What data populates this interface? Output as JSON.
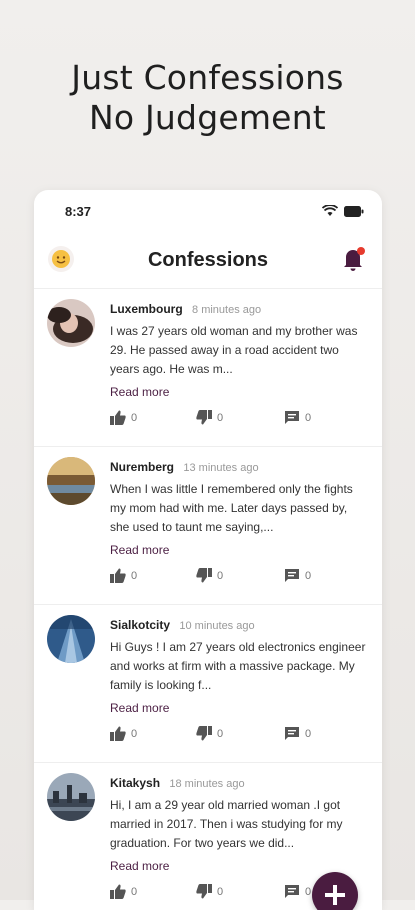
{
  "promo": {
    "line1": "Just Confessions",
    "line2": "No Judgement"
  },
  "status_bar": {
    "time": "8:37"
  },
  "app_bar": {
    "title": "Confessions"
  },
  "colors": {
    "accent": "#4a1c40",
    "notification_dot": "#e63b2e"
  },
  "feed": [
    {
      "city": "Luxembourg",
      "time_ago": "8 minutes ago",
      "text": "I was 27 years old woman and my brother was 29. He passed away in a road accident two years ago. He was m...",
      "read_more": "Read more",
      "likes": "0",
      "dislikes": "0",
      "comments": "0"
    },
    {
      "city": "Nuremberg",
      "time_ago": "13 minutes ago",
      "text": "When I was little I remembered only the fights my mom had with me. Later days passed by, she used to taunt me saying,...",
      "read_more": "Read more",
      "likes": "0",
      "dislikes": "0",
      "comments": "0"
    },
    {
      "city": "Sialkotcity",
      "time_ago": "10 minutes ago",
      "text": "Hi Guys ! I am 27 years old electronics engineer and works at firm with a massive package. My family is looking f...",
      "read_more": "Read more",
      "likes": "0",
      "dislikes": "0",
      "comments": "0"
    },
    {
      "city": "Kitakysh",
      "time_ago": "18 minutes ago",
      "text": "Hi, I am a 29 year old married woman .I got married in 2017. Then i was studying for my graduation. For two years we did...",
      "read_more": "Read more",
      "likes": "0",
      "dislikes": "0",
      "comments": "0"
    }
  ]
}
